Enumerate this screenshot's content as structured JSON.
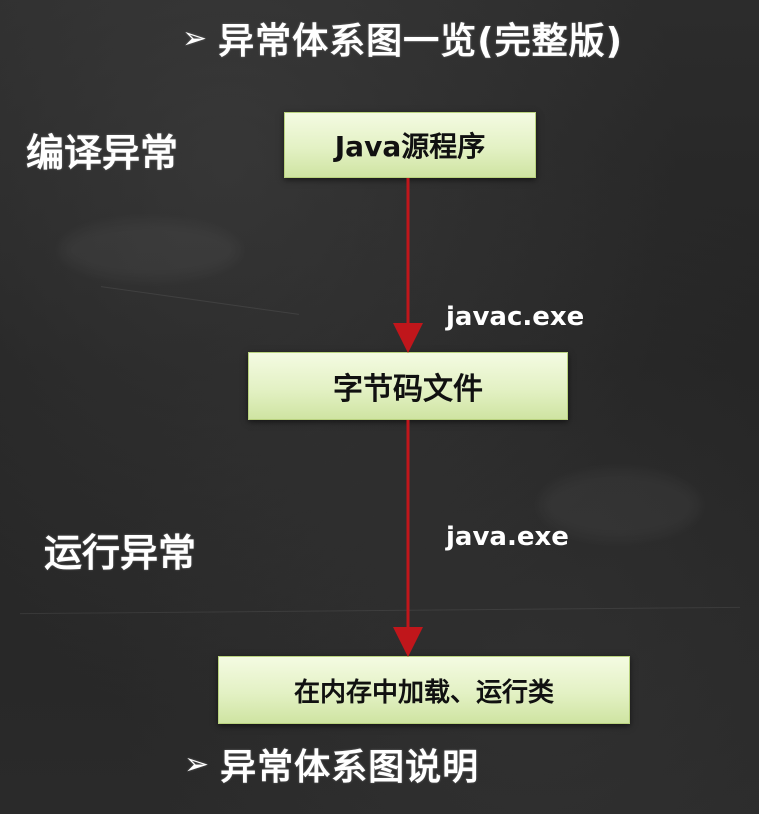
{
  "heading_top": {
    "marker": "➢",
    "text": "异常体系图一览(完整版)"
  },
  "labels": {
    "compile_exception": "编译异常",
    "runtime_exception": "运行异常"
  },
  "boxes": {
    "source": "Java源程序",
    "bytecode": "字节码文件",
    "load_run": "在内存中加载、运行类"
  },
  "tools": {
    "javac": "javac.exe",
    "java": "java.exe"
  },
  "heading_bottom": {
    "marker": "➢",
    "text": "异常体系图说明"
  },
  "colors": {
    "arrow": "#c0161b",
    "box_fill": "#e3f1c4",
    "board": "#2a2a2a"
  }
}
